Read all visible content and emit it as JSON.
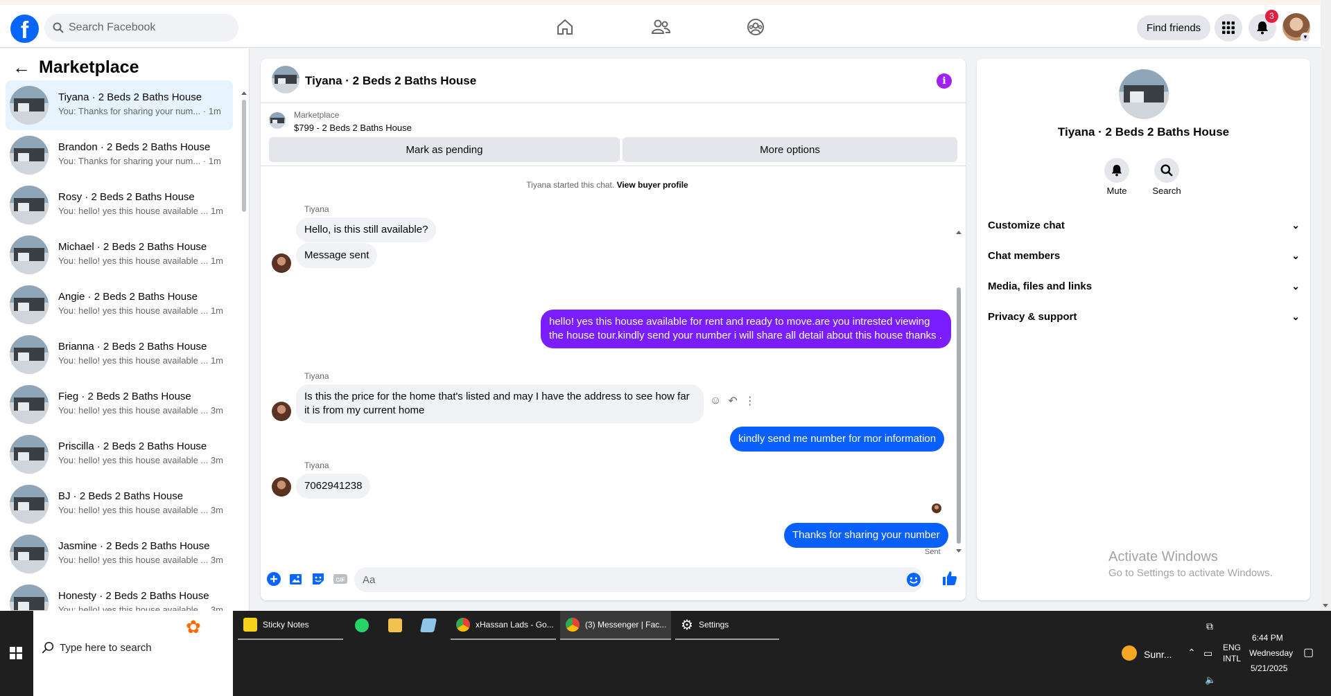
{
  "topbar": {
    "logo_letter": "f",
    "search_placeholder": "Search Facebook",
    "find_friends": "Find friends",
    "notification_count": "3"
  },
  "sidebar": {
    "title": "Marketplace",
    "conversations": [
      {
        "name": "Tiyana · 2 Beds 2 Baths House",
        "preview": "You: Thanks for sharing your num... · 1m"
      },
      {
        "name": "Brandon · 2 Beds 2 Baths House",
        "preview": "You: Thanks for sharing your num... · 1m"
      },
      {
        "name": "Rosy · 2 Beds 2 Baths House",
        "preview": "You: hello! yes this house available ... 1m"
      },
      {
        "name": "Michael · 2 Beds 2 Baths House",
        "preview": "You: hello! yes this house available ... 1m"
      },
      {
        "name": "Angie · 2 Beds 2 Baths House",
        "preview": "You: hello! yes this house available ... 1m"
      },
      {
        "name": "Brianna · 2 Beds 2 Baths House",
        "preview": "You: hello! yes this house available ... 1m"
      },
      {
        "name": "Fieg · 2 Beds 2 Baths House",
        "preview": "You: hello! yes this house available ... 3m"
      },
      {
        "name": "Priscilla · 2 Beds 2 Baths House",
        "preview": "You: hello! yes this house available ... 3m"
      },
      {
        "name": "BJ · 2 Beds 2 Baths House",
        "preview": "You: hello! yes this house available ... 3m"
      },
      {
        "name": "Jasmine · 2 Beds 2 Baths House",
        "preview": "You: hello! yes this house available ... 3m"
      },
      {
        "name": "Honesty · 2 Beds 2 Baths House",
        "preview": "You: hello! yes this house available ... 3m"
      }
    ]
  },
  "chat": {
    "title": "Tiyana · 2 Beds 2 Baths House",
    "listing_source": "Marketplace",
    "listing_price": "$799 - 2 Beds 2 Baths House",
    "mark_pending": "Mark as pending",
    "more_options": "More options",
    "started_text": "Tiyana started this chat.",
    "view_profile": "View buyer profile",
    "sender_name": "Tiyana",
    "messages": {
      "in1": "Hello, is this still available?",
      "in2": "Message sent",
      "out1": "hello! yes this house available for rent and ready to move.are you intrested viewing the house tour.kindly send your number i will share all detail about this house thanks .",
      "in3": "Is this the price for the home that's listed and may I have the address to see how far it is from my current home",
      "out2": "kindly send me number for mor information",
      "in4": "7062941238",
      "out3": "Thanks for sharing your number"
    },
    "sent_status": "Sent",
    "composer_placeholder": "Aa",
    "colors": {
      "outgoing": "#7a1eff",
      "outgoing_blue": "#0a60ff",
      "incoming": "#f0f2f5"
    }
  },
  "rpanel": {
    "title": "Tiyana · 2 Beds 2 Baths House",
    "mute": "Mute",
    "search": "Search",
    "rows": [
      "Customize chat",
      "Chat members",
      "Media, files and links",
      "Privacy & support"
    ],
    "activate_title": "Activate Windows",
    "activate_sub": "Go to Settings to activate Windows."
  },
  "taskbar": {
    "search_placeholder": "Type here to search",
    "apps": {
      "sticky": "Sticky Notes",
      "chrome1": "xHassan Lads - Go...",
      "chrome2": "(3) Messenger | Fac...",
      "settings": "Settings"
    },
    "weather": "Sunr...",
    "lang1": "ENG",
    "lang2": "INTL",
    "time": "6:44 PM",
    "day": "Wednesday",
    "date": "5/21/2025"
  }
}
